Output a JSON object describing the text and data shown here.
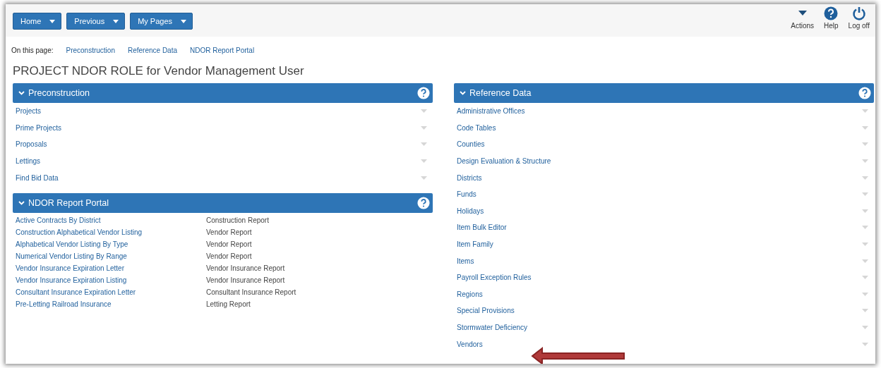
{
  "nav_buttons": [
    {
      "label": "Home"
    },
    {
      "label": "Previous"
    },
    {
      "label": "My Pages"
    }
  ],
  "header_actions": [
    {
      "kind": "actions",
      "label": "Actions"
    },
    {
      "kind": "help",
      "label": "Help"
    },
    {
      "kind": "logoff",
      "label": "Log off"
    }
  ],
  "on_this_page": {
    "label": "On this page:",
    "links": [
      "Preconstruction",
      "Reference Data",
      "NDOR Report Portal"
    ]
  },
  "page_title": "PROJECT NDOR ROLE for Vendor Management User",
  "left_panels": [
    {
      "kind": "list",
      "title": "Preconstruction",
      "expanded": true,
      "items": [
        "Projects",
        "Prime Projects",
        "Proposals",
        "Lettings",
        "Find Bid Data"
      ]
    },
    {
      "kind": "reports",
      "title": "NDOR Report Portal",
      "expanded": true,
      "reports": [
        {
          "name": "Active Contracts By District",
          "type": "Construction Report"
        },
        {
          "name": "Construction Alphabetical Vendor Listing",
          "type": "Vendor Report"
        },
        {
          "name": "Alphabetical Vendor Listing By Type",
          "type": "Vendor Report"
        },
        {
          "name": "Numerical Vendor Listing By Range",
          "type": "Vendor Report"
        },
        {
          "name": "Vendor Insurance Expiration Letter",
          "type": "Vendor Insurance Report"
        },
        {
          "name": "Vendor Insurance Expiration Listing",
          "type": "Vendor Insurance Report"
        },
        {
          "name": "Consultant Insurance Expiration Letter",
          "type": "Consultant Insurance Report"
        },
        {
          "name": "Pre-Letting Railroad Insurance",
          "type": "Letting Report"
        }
      ]
    }
  ],
  "right_panels": [
    {
      "kind": "list",
      "title": "Reference Data",
      "expanded": true,
      "items": [
        "Administrative Offices",
        "Code Tables",
        "Counties",
        "Design Evaluation & Structure",
        "Districts",
        "Funds",
        "Holidays",
        "Item Bulk Editor",
        "Item Family",
        "Items",
        "Payroll Exception Rules",
        "Regions",
        "Special Provisions",
        "Stormwater Deficiency",
        "Vendors"
      ]
    }
  ]
}
